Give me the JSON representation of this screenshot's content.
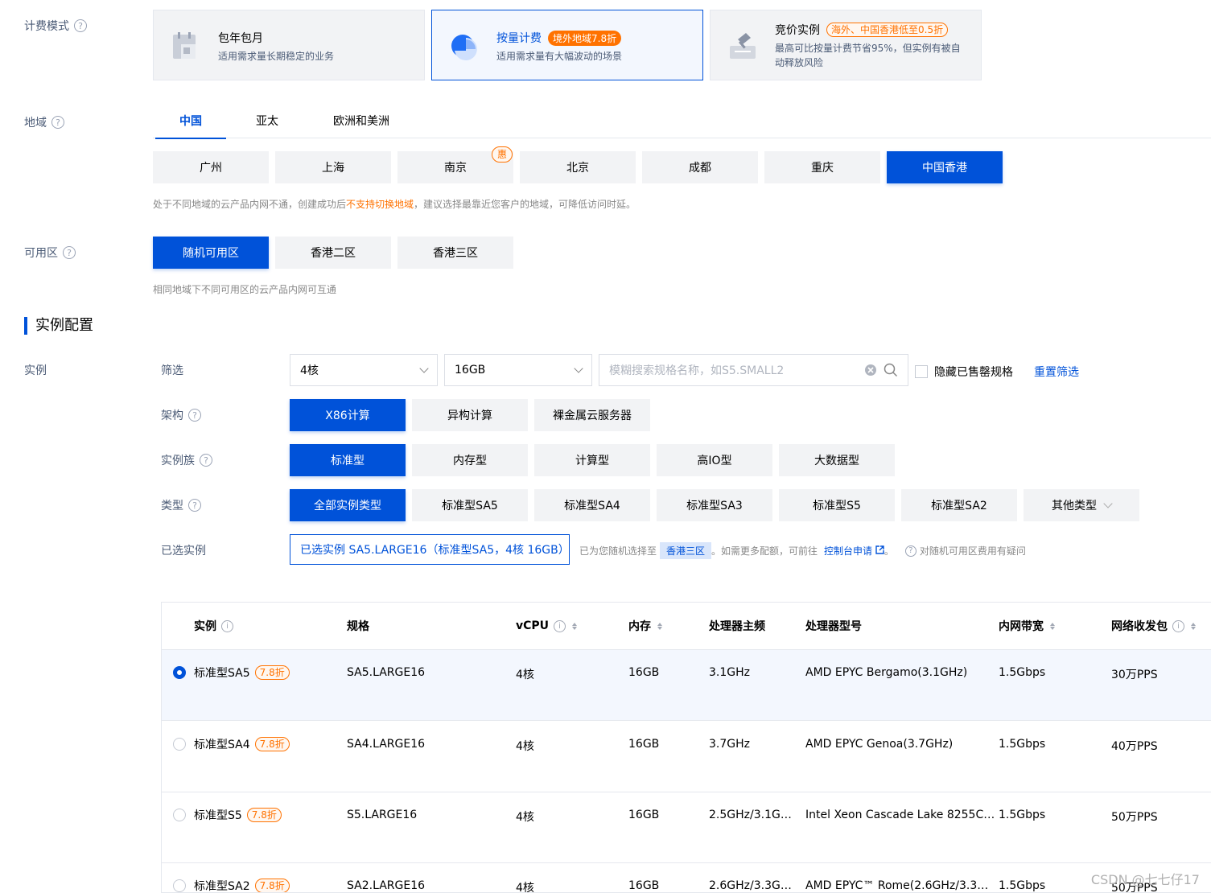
{
  "billing": {
    "label": "计费模式",
    "cards": [
      {
        "title": "包年包月",
        "desc": "适用需求量长期稳定的业务",
        "badge": ""
      },
      {
        "title": "按量计费",
        "desc": "适用需求量有大幅波动的场景",
        "badge": "境外地域7.8折"
      },
      {
        "title": "竞价实例",
        "desc": "最高可比按量计费节省95%，但实例有被自动释放风险",
        "badge": "海外、中国香港低至0.5折"
      }
    ]
  },
  "region": {
    "label": "地域",
    "tabs": [
      "中国",
      "亚太",
      "欧洲和美洲"
    ],
    "cities": [
      "广州",
      "上海",
      "南京",
      "北京",
      "成都",
      "重庆",
      "中国香港"
    ],
    "promo_tag": "惠",
    "hint_before": "处于不同地域的云产品内网不通，创建成功后",
    "hint_warn": "不支持切换地域",
    "hint_after": "，建议选择最靠近您客户的地域，可降低访问时延。"
  },
  "zone": {
    "label": "可用区",
    "options": [
      "随机可用区",
      "香港二区",
      "香港三区"
    ],
    "hint": "相同地域下不同可用区的云产品内网可互通"
  },
  "instance_config": {
    "section_title": "实例配置",
    "instance_label": "实例",
    "filter_label": "筛选",
    "cpu_value": "4核",
    "mem_value": "16GB",
    "search_placeholder": "模糊搜索规格名称，如S5.SMALL2",
    "hide_soldout": "隐藏已售罄规格",
    "reset": "重置筛选",
    "arch_label": "架构",
    "arch": [
      "X86计算",
      "异构计算",
      "裸金属云服务器"
    ],
    "family_label": "实例族",
    "family": [
      "标准型",
      "内存型",
      "计算型",
      "高IO型",
      "大数据型"
    ],
    "type_label": "类型",
    "types": [
      "全部实例类型",
      "标准型SA5",
      "标准型SA4",
      "标准型SA3",
      "标准型S5",
      "标准型SA2",
      "其他类型"
    ],
    "selected_label": "已选实例",
    "selected_value": "已选实例 SA5.LARGE16（标准型SA5，4核 16GB）",
    "random_text": "已为您随机选择至",
    "random_zone": "香港三区",
    "quota_text": "。如需更多配额，可前往",
    "console_link": "控制台申请",
    "period": "。",
    "question": "对随机可用区费用有疑问"
  },
  "table": {
    "headers": [
      "实例",
      "规格",
      "vCPU",
      "内存",
      "处理器主频",
      "处理器型号",
      "内网带宽",
      "网络收发包"
    ],
    "rows": [
      {
        "name": "标准型SA5",
        "discount": "7.8折",
        "spec": "SA5.LARGE16",
        "vcpu": "4核",
        "mem": "16GB",
        "freq": "3.1GHz",
        "cpu": "AMD EPYC Bergamo(3.1GHz)",
        "bw": "1.5Gbps",
        "pps": "30万PPS"
      },
      {
        "name": "标准型SA4",
        "discount": "7.8折",
        "spec": "SA4.LARGE16",
        "vcpu": "4核",
        "mem": "16GB",
        "freq": "3.7GHz",
        "cpu": "AMD EPYC Genoa(3.7GHz)",
        "bw": "1.5Gbps",
        "pps": "40万PPS"
      },
      {
        "name": "标准型S5",
        "discount": "7.8折",
        "spec": "S5.LARGE16",
        "vcpu": "4核",
        "mem": "16GB",
        "freq": "2.5GHz/3.1G…",
        "cpu": "Intel Xeon Cascade Lake 8255C…",
        "bw": "1.5Gbps",
        "pps": "50万PPS"
      },
      {
        "name": "标准型SA2",
        "discount": "7.8折",
        "spec": "SA2.LARGE16",
        "vcpu": "4核",
        "mem": "16GB",
        "freq": "2.6GHz/3.3G…",
        "cpu": "AMD EPYC™ Rome(2.6GHz/3.3…",
        "bw": "1.5Gbps",
        "pps": "50万PPS"
      }
    ]
  },
  "watermark": "CSDN @七七仔17",
  "colors": {
    "accent": "#0052d9",
    "warn": "#ff7200",
    "muted": "#4b5b76"
  }
}
